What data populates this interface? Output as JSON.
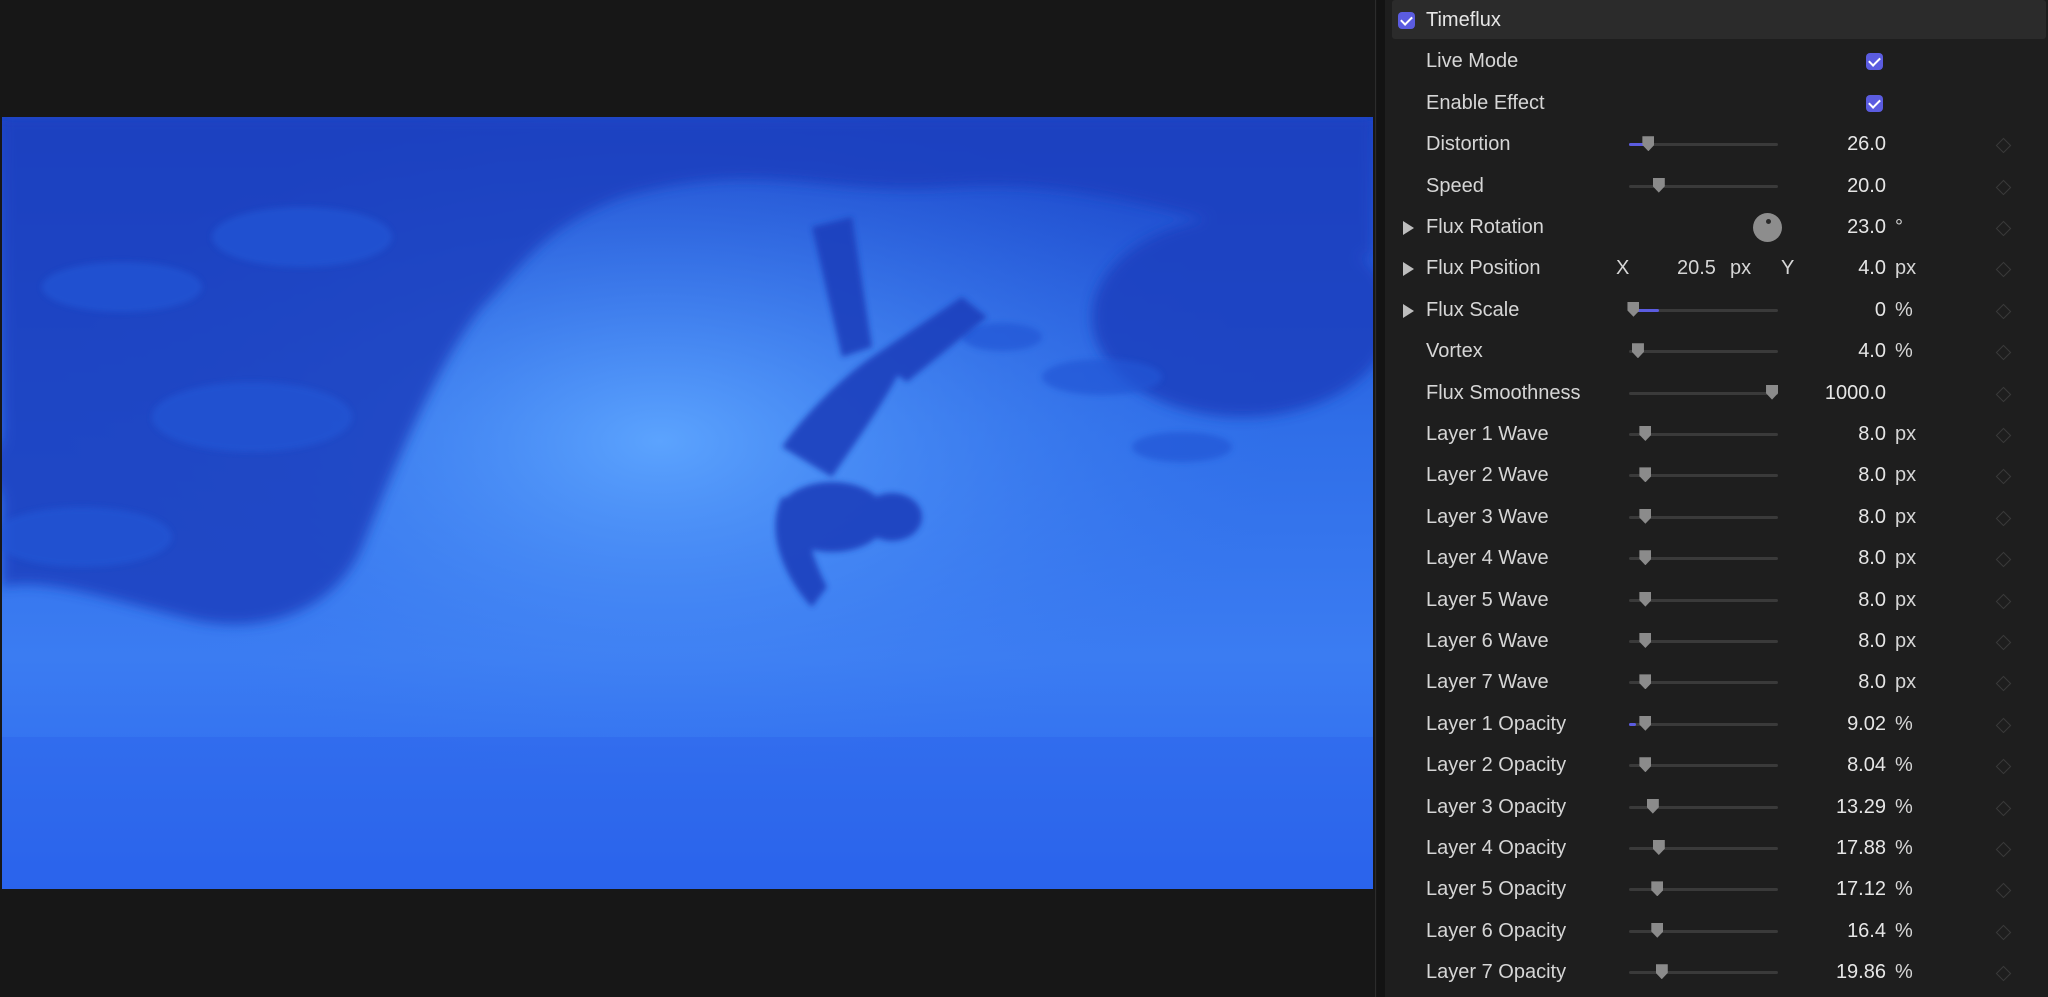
{
  "header": {
    "title": "Timeflux",
    "checked": true
  },
  "toggles": [
    {
      "label": "Live Mode",
      "checked": true
    },
    {
      "label": "Enable Effect",
      "checked": true
    }
  ],
  "params": [
    {
      "label": "Distortion",
      "value": "26.0",
      "unit": "",
      "slider": 0.13,
      "fill": 0.13
    },
    {
      "label": "Speed",
      "value": "20.0",
      "unit": "",
      "slider": 0.2
    },
    {
      "label": "Flux Rotation",
      "value": "23.0",
      "unit": "°",
      "dial": true,
      "disclosure": true
    },
    {
      "label": "Flux Position",
      "disclosure": true,
      "x_label": "X",
      "x_value": "20.5",
      "x_unit": "px",
      "y_label": "Y",
      "y_value": "4.0",
      "y_unit": "px"
    },
    {
      "label": "Flux Scale",
      "value": "0",
      "unit": "%",
      "slider": 0.03,
      "fill": 0.2,
      "disclosure": true
    },
    {
      "label": "Vortex",
      "value": "4.0",
      "unit": "%",
      "slider": 0.06
    },
    {
      "label": "Flux Smoothness",
      "value": "1000.0",
      "unit": "",
      "slider": 0.96
    },
    {
      "label": "Layer 1 Wave",
      "value": "8.0",
      "unit": "px",
      "slider": 0.11
    },
    {
      "label": "Layer 2 Wave",
      "value": "8.0",
      "unit": "px",
      "slider": 0.11
    },
    {
      "label": "Layer 3 Wave",
      "value": "8.0",
      "unit": "px",
      "slider": 0.11
    },
    {
      "label": "Layer 4 Wave",
      "value": "8.0",
      "unit": "px",
      "slider": 0.11
    },
    {
      "label": "Layer 5 Wave",
      "value": "8.0",
      "unit": "px",
      "slider": 0.11
    },
    {
      "label": "Layer 6 Wave",
      "value": "8.0",
      "unit": "px",
      "slider": 0.11
    },
    {
      "label": "Layer 7 Wave",
      "value": "8.0",
      "unit": "px",
      "slider": 0.11
    },
    {
      "label": "Layer 1 Opacity",
      "value": "9.02",
      "unit": "%",
      "slider": 0.11,
      "fill": 0.05
    },
    {
      "label": "Layer 2 Opacity",
      "value": "8.04",
      "unit": "%",
      "slider": 0.11
    },
    {
      "label": "Layer 3 Opacity",
      "value": "13.29",
      "unit": "%",
      "slider": 0.16
    },
    {
      "label": "Layer 4 Opacity",
      "value": "17.88",
      "unit": "%",
      "slider": 0.2
    },
    {
      "label": "Layer 5 Opacity",
      "value": "17.12",
      "unit": "%",
      "slider": 0.19
    },
    {
      "label": "Layer 6 Opacity",
      "value": "16.4",
      "unit": "%",
      "slider": 0.19
    },
    {
      "label": "Layer 7 Opacity",
      "value": "19.86",
      "unit": "%",
      "slider": 0.22
    }
  ],
  "colors": {
    "accent": "#5b5ce0",
    "panel": "#1e1e1e",
    "water": "#2f6ee8"
  },
  "icons": {
    "checkbox": "checkmark-icon",
    "disclosure": "disclosure-triangle-icon",
    "keyframe": "keyframe-diamond-icon",
    "dial": "rotation-dial-icon"
  }
}
